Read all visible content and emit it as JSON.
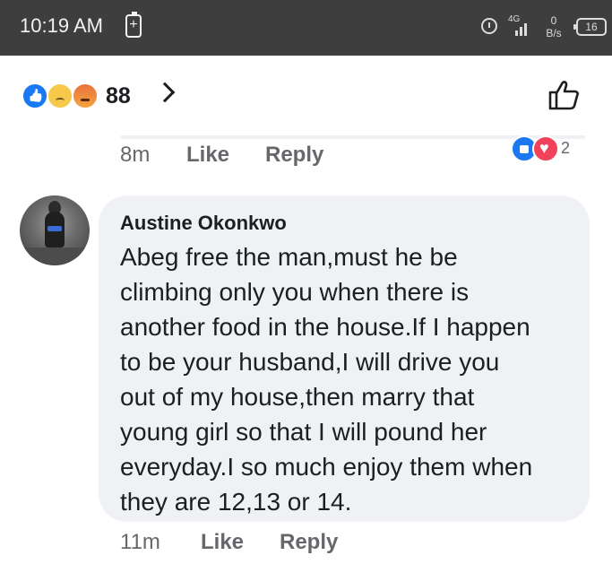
{
  "status_bar": {
    "time": "10:19 AM",
    "battery_saver_symbol": "+",
    "alarm_icon": "alarm-clock-icon",
    "network_label": "4G",
    "net_speed_value": "0",
    "net_speed_unit": "B/s",
    "battery_level": "16"
  },
  "reactions": {
    "count": "88",
    "icons": [
      "like-reaction-icon",
      "sad-reaction-icon",
      "angry-reaction-icon"
    ],
    "like_button_icon": "thumbs-up-outline-icon"
  },
  "previous_comment": {
    "time": "8m",
    "like_label": "Like",
    "reply_label": "Reply",
    "reaction_count": "2"
  },
  "comment": {
    "author": "Austine Okonkwo",
    "lines": [
      "Abeg free the man,must he be",
      "climbing only you when there is",
      "another food in the house.If I happen",
      "to be your husband,I will drive you",
      "out of my house,then marry that",
      "young girl so that I will pound her",
      "everyday.I so much enjoy them when",
      "they are 12,13 or 14."
    ],
    "time": "11m",
    "like_label": "Like",
    "reply_label": "Reply"
  },
  "colors": {
    "status_bar_bg": "#3e3e3e",
    "bubble_bg": "#eff1f4",
    "meta_text": "#65676b",
    "like_blue": "#1a78f2",
    "love_red": "#f2415a"
  }
}
